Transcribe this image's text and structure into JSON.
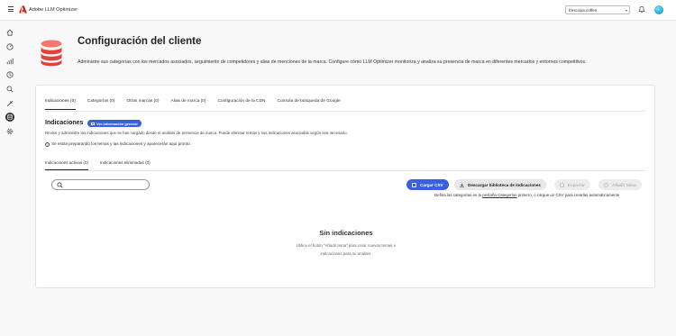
{
  "app": {
    "title": "Adobe LLM Optimizer"
  },
  "org_select": {
    "value": "frescopa.coffee"
  },
  "colors": {
    "accent": "#3a5fe0",
    "brand_red": "#eb1000",
    "icon_red": "#e3413a"
  },
  "siderail": [
    "home-icon",
    "dashboard-icon",
    "chart-icon",
    "history-icon",
    "search-icon",
    "tools-icon",
    "database-icon",
    "settings-icon"
  ],
  "page": {
    "title": "Configuración del cliente",
    "description": "Administre sus categorías con los mercados asociados, seguimiento de competidores y alias de menciones de la marca. Configure cómo LLM Optimizer monitoriza y analiza su presencia de marca en diferentes mercados y entornos competitivos."
  },
  "tabs": [
    {
      "label": "Indicaciones (0)",
      "active": true
    },
    {
      "label": "Categorías (0)"
    },
    {
      "label": "Otras marcas (0)"
    },
    {
      "label": "Alias de marca (0)"
    },
    {
      "label": "Configuración de la CDN"
    },
    {
      "label": "Consola de búsqueda de Google"
    }
  ],
  "section": {
    "title": "Indicaciones",
    "overview_button": "Ver información general",
    "description": "Revise y administre las indicaciones que se han cargado desde el análisis de presencia de marca. Puede eliminar temas y sus indicaciones asociadas según sea necesario.",
    "info": "Se están preparando los temas y las indicaciones y aparecerán aquí pronto."
  },
  "subtabs": [
    {
      "label": "Indicaciones activas (0)",
      "active": true
    },
    {
      "label": "Indicaciones eliminadas (0)"
    }
  ],
  "search": {
    "placeholder": ""
  },
  "actions": {
    "upload_csv": "Cargar CSV",
    "download_library": "Descargar biblioteca de indicaciones",
    "export": "Exportar",
    "add_topic": "Añadir tema"
  },
  "hint": {
    "before": "Defina las categorías en la ",
    "link": "pestaña Categorías",
    "after": " primero, o cargue un CSV para crearlas automáticamente"
  },
  "empty": {
    "title": "Sin indicaciones",
    "line1": "Utilice el botón “Añadir tema” para crear nuevos temas e",
    "line2": "indicaciones para su análisis."
  }
}
